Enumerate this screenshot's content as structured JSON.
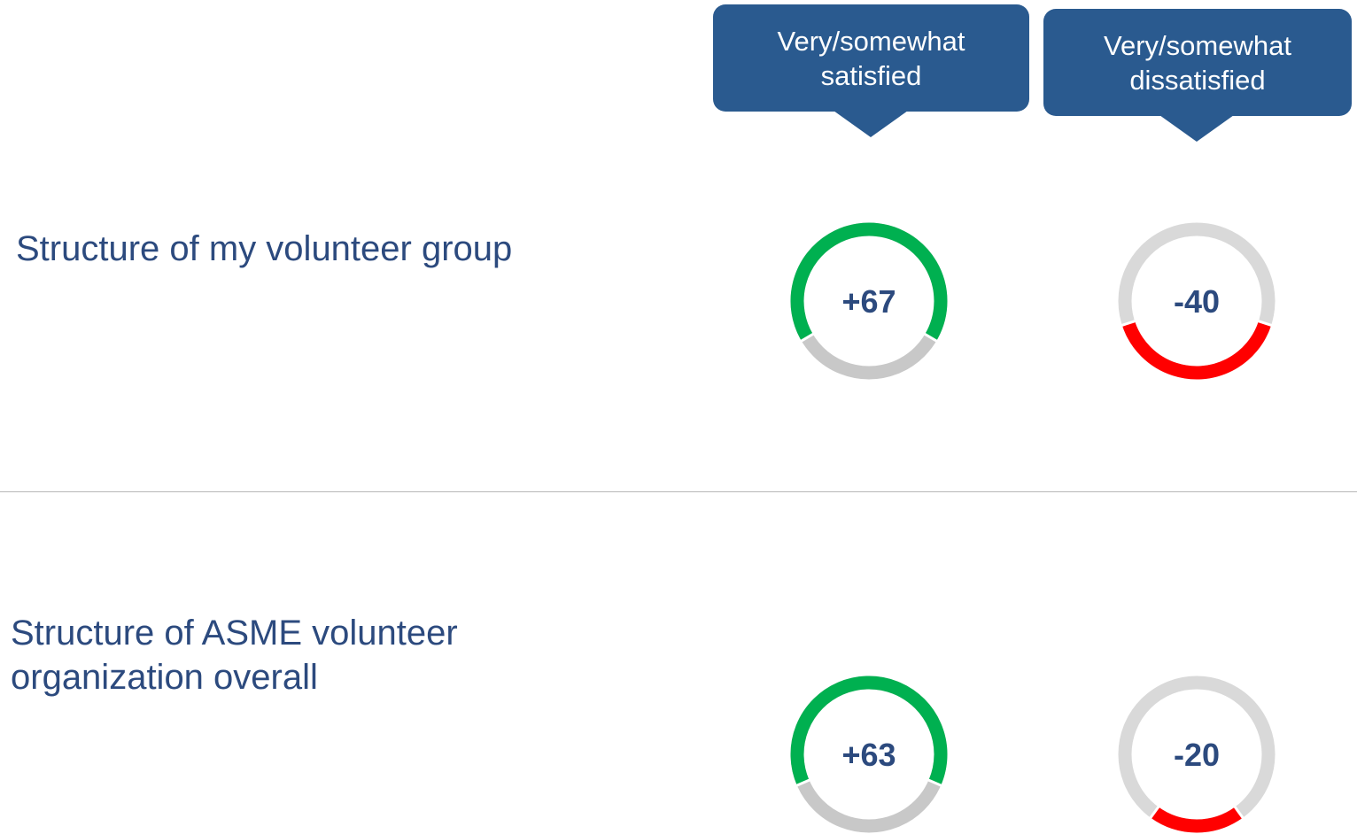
{
  "columns": [
    {
      "label": "Very/somewhat\nsatisfied"
    },
    {
      "label": "Very/somewhat\ndissatisfied"
    }
  ],
  "rows": [
    {
      "label": "Structure of my volunteer group"
    },
    {
      "label": " Structure of ASME volunteer\norganization overall"
    }
  ],
  "chart_data": {
    "type": "donut",
    "categories": [
      "Structure of my volunteer group",
      "Structure of ASME volunteer organization overall"
    ],
    "series": [
      {
        "name": "Very/somewhat satisfied",
        "values": [
          67,
          63
        ],
        "labels": [
          "+67",
          "+63"
        ],
        "color": "#00b050",
        "track_color": "#c8c8c8"
      },
      {
        "name": "Very/somewhat dissatisfied",
        "values": [
          40,
          20
        ],
        "labels": [
          "-40",
          "-20"
        ],
        "color": "#ff0000",
        "track_color": "#d9d9d9"
      }
    ]
  }
}
